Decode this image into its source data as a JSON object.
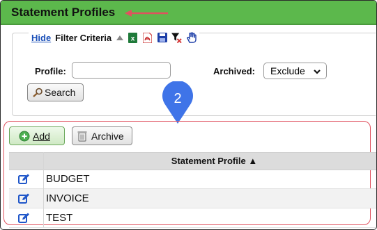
{
  "page": {
    "title": "Statement Profiles"
  },
  "filter": {
    "hide_label": "Hide",
    "criteria_label": "Filter Criteria",
    "toolbar_icons": [
      "collapse-arrow-icon",
      "excel-export-icon",
      "pdf-export-icon",
      "save-icon",
      "clear-filter-icon",
      "touch-icon"
    ],
    "profile_label": "Profile:",
    "profile_value": "",
    "archived_label": "Archived:",
    "archived_value": "Exclude",
    "search_label": "Search"
  },
  "annotation": {
    "badge_number": "2"
  },
  "actions": {
    "add_label": "Add",
    "archive_label": "Archive"
  },
  "table": {
    "header": "Statement Profile ▲",
    "rows": [
      {
        "name": "BUDGET"
      },
      {
        "name": "INVOICE"
      },
      {
        "name": "TEST"
      }
    ]
  },
  "colors": {
    "title_bar": "#5cb84c",
    "link": "#1a4fb8",
    "annotation_red": "#e0525f",
    "badge_blue": "#3f74e8"
  }
}
